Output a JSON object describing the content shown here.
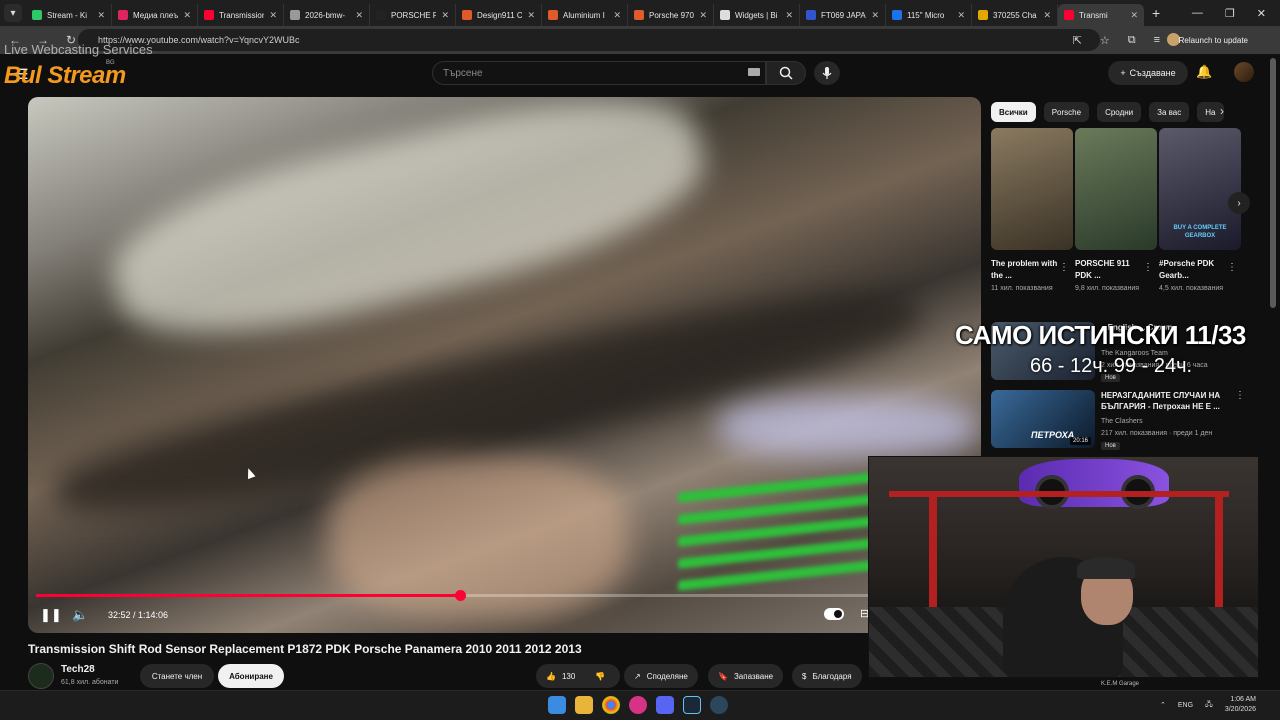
{
  "browser": {
    "tabs": [
      {
        "title": "Stream - Ki",
        "color": "#2ec866"
      },
      {
        "title": "Медиа плеъ",
        "color": "#e0245e"
      },
      {
        "title": "Transmission",
        "color": "#ff0033"
      },
      {
        "title": "2026-bmw-",
        "color": "#999999"
      },
      {
        "title": "PORSCHE PA",
        "color": "#222222"
      },
      {
        "title": "Design911 C",
        "color": "#e05a2b"
      },
      {
        "title": "Aluminium I",
        "color": "#e05a2b"
      },
      {
        "title": "Porsche 970",
        "color": "#e05a2b"
      },
      {
        "title": "Widgets | Bi",
        "color": "#dddddd"
      },
      {
        "title": "FT069 JAPAN",
        "color": "#3355cc"
      },
      {
        "title": "115\" Micro",
        "color": "#1a73e8"
      },
      {
        "title": "370255 Cha",
        "color": "#e0a800"
      },
      {
        "title": "Transmi",
        "color": "#ff0033",
        "active": true
      }
    ],
    "url": "https://www.youtube.com/watch?v=YqncvY2WUBc",
    "relaunch_label": "Relaunch to update"
  },
  "youtube": {
    "logo_text": "Bul Stream",
    "logo_sub": "Live Webcasting Services",
    "region": "BG",
    "search_placeholder": "Търсене",
    "create_label": "Създаване"
  },
  "player": {
    "progress": 0.452,
    "time_current": "32:52",
    "time_total": "1:14:06",
    "timecode": "32:52 / 1:14:06"
  },
  "video": {
    "title": "Transmission Shift Rod Sensor Replacement P1872 PDK Porsche Panamera 2010 2011 2012 2013",
    "channel": "Tech28",
    "subscribers": "61,8 хил. абонати",
    "member_label": "Станете член",
    "subscribe_label": "Абониране",
    "likes": "130",
    "share_label": "Споделяне",
    "save_label": "Запазване",
    "thanks_label": "Благодаря"
  },
  "sidebar": {
    "chips": [
      "Всички",
      "Porsche",
      "Сродни",
      "За вас",
      "На"
    ],
    "shorts": [
      {
        "title": "The problem with the ...",
        "views": "11 хил. показвания",
        "colors": [
          "#8a7a60",
          "#3a3226"
        ]
      },
      {
        "title": "PORSCHE 911 PDK ...",
        "views": "9,8 хил. показвания",
        "colors": [
          "#6a7a5a",
          "#2a3a2a"
        ]
      },
      {
        "title": "#Porsche PDK Gearb...",
        "views": "4,5 хил. показвания",
        "colors": [
          "#5a5a6a",
          "#1a1a2a"
        ]
      }
    ],
    "short_badge": "BUY A COMPLETE GEARBOX",
    "recommended": [
      {
        "title": "...English ... Crown",
        "channel": "The Kangaroos Team",
        "meta": "2 хил. показвания · преди 6 часа",
        "badge": "Нов"
      },
      {
        "title": "НЕРАЗГАДАНИТЕ СЛУЧАИ НА БЪЛГАРИЯ - Петрохан НЕ Е ...",
        "channel": "The Clashers",
        "meta": "217 хил. показвания · преди 1 ден",
        "badge": "Нов",
        "duration": "20:16",
        "thumb_text": "ПЕТРОХА"
      }
    ]
  },
  "overlay": {
    "line1": "САМО ИСТИНСКИ 11/33",
    "line2": "66 - 12ч. 99 - 24ч."
  },
  "webcam": {
    "label": "K.E.M Garage"
  },
  "taskbar": {
    "lang": "ENG",
    "time": "1:06 AM",
    "date": "3/20/2026"
  }
}
